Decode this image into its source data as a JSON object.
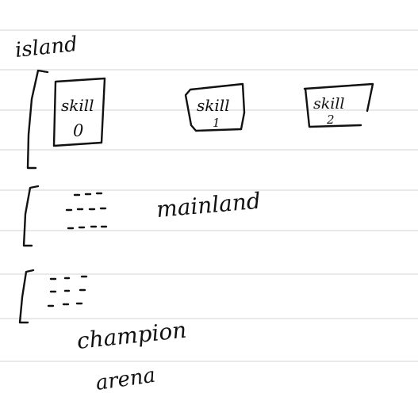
{
  "page": {
    "ruled_line_color": "#d3d3d3",
    "ink_color": "#111111"
  },
  "labels": {
    "island": "island",
    "mainland": "mainland",
    "champion": "champion",
    "arena": "arena"
  },
  "skills": [
    {
      "word": "skill",
      "number": "0"
    },
    {
      "word": "skill",
      "number": "1"
    },
    {
      "word": "skill",
      "number": "2"
    }
  ]
}
